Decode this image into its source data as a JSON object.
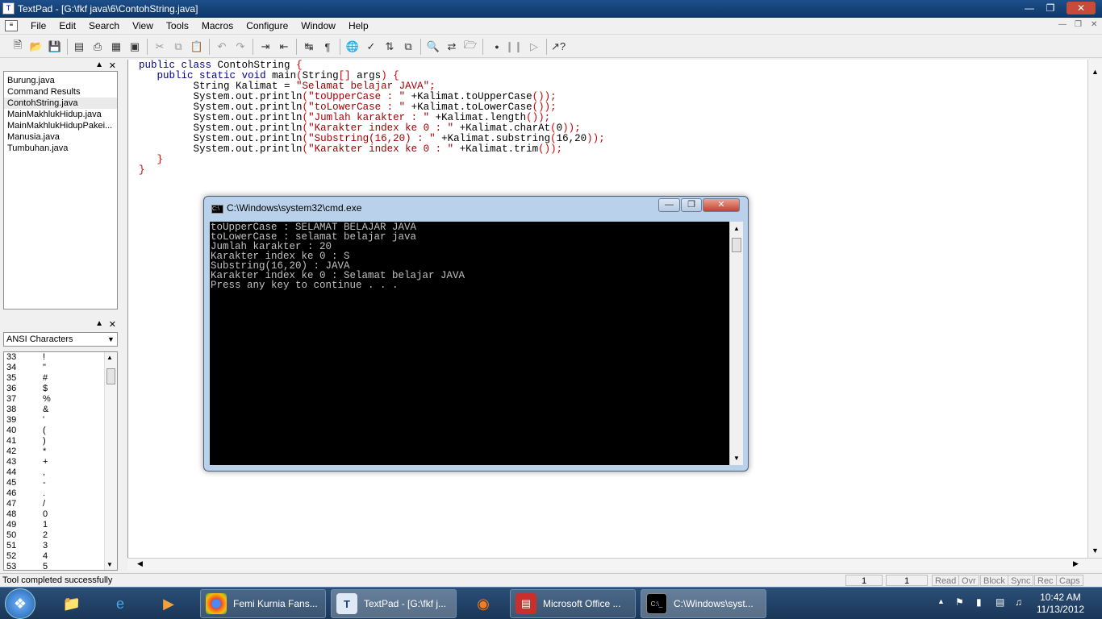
{
  "window": {
    "title": "TextPad - [G:\\fkf java\\6\\ContohString.java]"
  },
  "menus": [
    "File",
    "Edit",
    "Search",
    "View",
    "Tools",
    "Macros",
    "Configure",
    "Window",
    "Help"
  ],
  "left_pane": {
    "documents": [
      "Burung.java",
      "Command Results",
      "ContohString.java",
      "MainMakhlukHidup.java",
      "MainMakhlukHidupPakei...",
      "Manusia.java",
      "Tumbuhan.java"
    ],
    "selected_document": "ContohString.java",
    "charset_selector": "ANSI Characters",
    "ansi_rows": [
      {
        "code": "33",
        "char": "!"
      },
      {
        "code": "34",
        "char": "\""
      },
      {
        "code": "35",
        "char": "#"
      },
      {
        "code": "36",
        "char": "$"
      },
      {
        "code": "37",
        "char": "%"
      },
      {
        "code": "38",
        "char": "&"
      },
      {
        "code": "39",
        "char": "'"
      },
      {
        "code": "40",
        "char": "("
      },
      {
        "code": "41",
        "char": ")"
      },
      {
        "code": "42",
        "char": "*"
      },
      {
        "code": "43",
        "char": "+"
      },
      {
        "code": "44",
        "char": ","
      },
      {
        "code": "45",
        "char": "-"
      },
      {
        "code": "46",
        "char": "."
      },
      {
        "code": "47",
        "char": "/"
      },
      {
        "code": "48",
        "char": "0"
      },
      {
        "code": "49",
        "char": "1"
      },
      {
        "code": "50",
        "char": "2"
      },
      {
        "code": "51",
        "char": "3"
      },
      {
        "code": "52",
        "char": "4"
      },
      {
        "code": "53",
        "char": "5"
      }
    ]
  },
  "editor": {
    "lines": [
      "public class ContohString {",
      "   public static void main(String[] args) {",
      "         String Kalimat = \"Selamat belajar JAVA\";",
      "         System.out.println(\"toUpperCase : \" +Kalimat.toUpperCase());",
      "         System.out.println(\"toLowerCase : \" +Kalimat.toLowerCase());",
      "         System.out.println(\"Jumlah karakter : \" +Kalimat.length());",
      "         System.out.println(\"Karakter index ke 0 : \" +Kalimat.charAt(0));",
      "         System.out.println(\"Substring(16,20) : \" +Kalimat.substring(16,20));",
      "         System.out.println(\"Karakter index ke 0 : \" +Kalimat.trim());",
      "   }",
      "}"
    ]
  },
  "console": {
    "title": "C:\\Windows\\system32\\cmd.exe",
    "output": [
      "toUpperCase : SELAMAT BELAJAR JAVA",
      "toLowerCase : selamat belajar java",
      "Jumlah karakter : 20",
      "Karakter index ke 0 : S",
      "Substring(16,20) : JAVA",
      "Karakter index ke 0 : Selamat belajar JAVA",
      "Press any key to continue . . ."
    ]
  },
  "status": {
    "message": "Tool completed successfully",
    "line": "1",
    "col": "1",
    "indicators": [
      "Read",
      "Ovr",
      "Block",
      "Sync",
      "Rec",
      "Caps"
    ]
  },
  "taskbar": {
    "tasks": [
      "Femi Kurnia Fans...",
      "TextPad - [G:\\fkf j...",
      "Microsoft Office ...",
      "C:\\Windows\\syst..."
    ],
    "time": "10:42 AM",
    "date": "11/13/2012"
  }
}
